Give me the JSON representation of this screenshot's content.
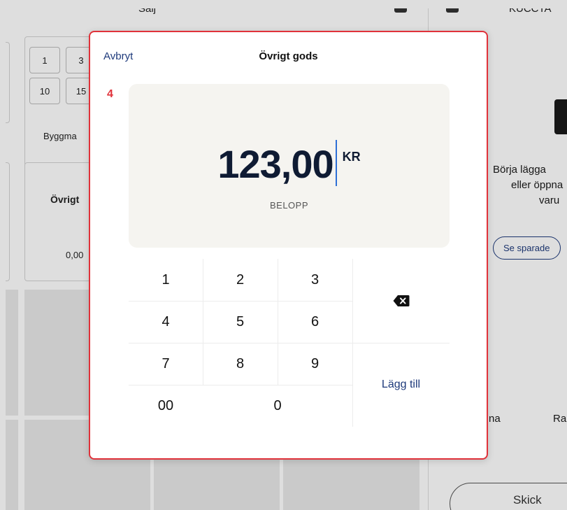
{
  "background": {
    "top": {
      "title_fragment": "Sälj",
      "right_fragment": "KUCCTA"
    },
    "tiles": {
      "quick_values_row1": [
        "1",
        "3"
      ],
      "quick_values_row2": [
        "10",
        "15"
      ],
      "category_label": "Byggma",
      "other_label": "Övrigt",
      "other_price": "0,00"
    },
    "right_panel": {
      "empty_line1": "Börja lägga",
      "empty_line2": "eller öppna",
      "empty_line3": "varu",
      "saved_button": "Se sparade",
      "bottom_left": "na",
      "bottom_right": "Ra",
      "send_button": "Skick"
    }
  },
  "modal": {
    "cancel_label": "Avbryt",
    "title": "Övrigt gods",
    "step_badge": "4",
    "amount": "123,00",
    "currency": "KR",
    "amount_label": "BELOPP",
    "keys": [
      "1",
      "2",
      "3",
      "4",
      "5",
      "6",
      "7",
      "8",
      "9",
      "00",
      "0"
    ],
    "add_label": "Lägg till",
    "accent_color": "#1e3a7b",
    "highlight_color": "#e0323a"
  }
}
